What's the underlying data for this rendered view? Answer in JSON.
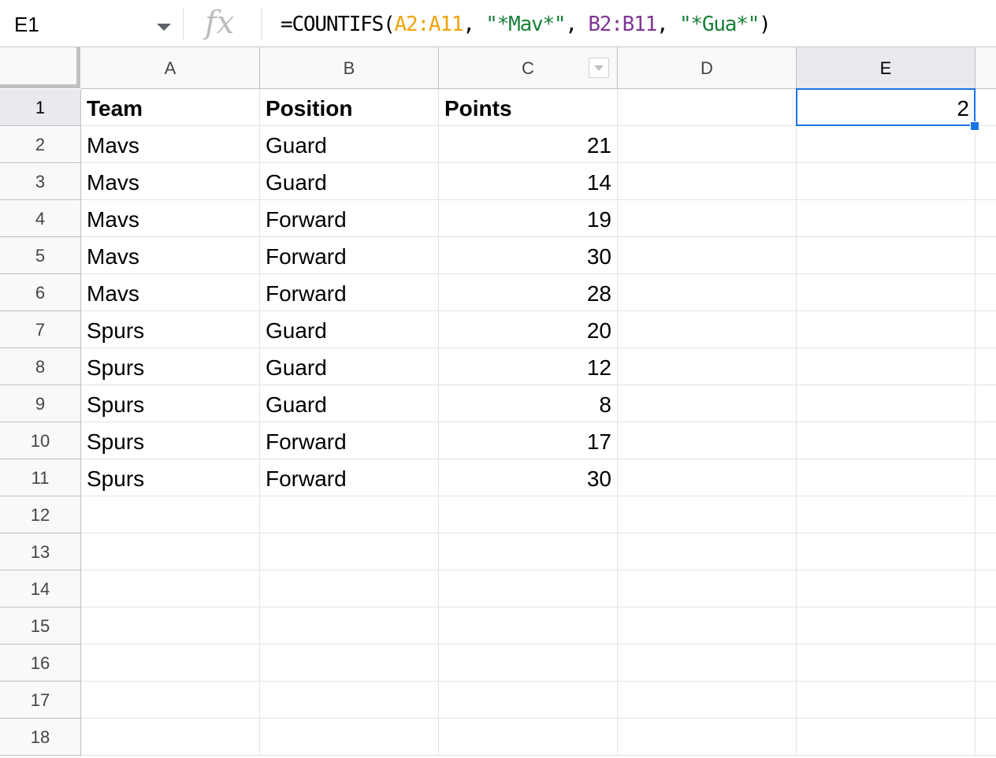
{
  "name_box": {
    "value": "E1"
  },
  "formula_bar": {
    "fx_label": "fx",
    "tokens": [
      {
        "text": "=COUNTIFS(",
        "kind": "plain"
      },
      {
        "text": "A2:A11",
        "kind": "range-a"
      },
      {
        "text": ", ",
        "kind": "plain"
      },
      {
        "text": "\"*Mav*\"",
        "kind": "string"
      },
      {
        "text": ", ",
        "kind": "plain"
      },
      {
        "text": "B2:B11",
        "kind": "range-b"
      },
      {
        "text": ", ",
        "kind": "plain"
      },
      {
        "text": "\"*Gua*\"",
        "kind": "string"
      },
      {
        "text": ")",
        "kind": "plain"
      }
    ]
  },
  "colors": {
    "range_a": "#f0a30a",
    "range_b": "#7e3794",
    "string": "#188038",
    "selection": "#1a73e8"
  },
  "sheet": {
    "columns": [
      "A",
      "B",
      "C",
      "D",
      "E"
    ],
    "filter_column": "C",
    "selected_cell": {
      "col": "E",
      "row": "1"
    },
    "row_numbers": [
      "1",
      "2",
      "3",
      "4",
      "5",
      "6",
      "7",
      "8",
      "9",
      "10",
      "11",
      "12",
      "13",
      "14",
      "15",
      "16",
      "17",
      "18"
    ],
    "rows": [
      [
        "Team",
        "Position",
        "Points",
        "",
        "2"
      ],
      [
        "Mavs",
        "Guard",
        "21",
        "",
        ""
      ],
      [
        "Mavs",
        "Guard",
        "14",
        "",
        ""
      ],
      [
        "Mavs",
        "Forward",
        "19",
        "",
        ""
      ],
      [
        "Mavs",
        "Forward",
        "30",
        "",
        ""
      ],
      [
        "Mavs",
        "Forward",
        "28",
        "",
        ""
      ],
      [
        "Spurs",
        "Guard",
        "20",
        "",
        ""
      ],
      [
        "Spurs",
        "Guard",
        "12",
        "",
        ""
      ],
      [
        "Spurs",
        "Guard",
        "8",
        "",
        ""
      ],
      [
        "Spurs",
        "Forward",
        "17",
        "",
        ""
      ],
      [
        "Spurs",
        "Forward",
        "30",
        "",
        ""
      ],
      [
        "",
        "",
        "",
        "",
        ""
      ],
      [
        "",
        "",
        "",
        "",
        ""
      ],
      [
        "",
        "",
        "",
        "",
        ""
      ],
      [
        "",
        "",
        "",
        "",
        ""
      ],
      [
        "",
        "",
        "",
        "",
        ""
      ],
      [
        "",
        "",
        "",
        "",
        ""
      ],
      [
        "",
        "",
        "",
        "",
        ""
      ]
    ]
  }
}
